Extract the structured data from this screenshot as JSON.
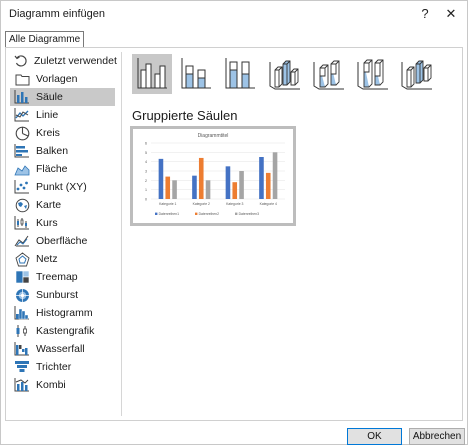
{
  "window": {
    "title": "Diagramm einfügen",
    "help": "?",
    "close": "✕"
  },
  "tabs": [
    {
      "label": "Alle Diagramme"
    }
  ],
  "sidebar": {
    "items": [
      {
        "label": "Zuletzt verwendet",
        "icon": "recent-icon"
      },
      {
        "label": "Vorlagen",
        "icon": "folder-icon"
      },
      {
        "label": "Säule",
        "icon": "column-chart-icon",
        "selected": true
      },
      {
        "label": "Linie",
        "icon": "line-chart-icon"
      },
      {
        "label": "Kreis",
        "icon": "pie-chart-icon"
      },
      {
        "label": "Balken",
        "icon": "bar-chart-icon"
      },
      {
        "label": "Fläche",
        "icon": "area-chart-icon"
      },
      {
        "label": "Punkt (XY)",
        "icon": "scatter-chart-icon"
      },
      {
        "label": "Karte",
        "icon": "map-chart-icon"
      },
      {
        "label": "Kurs",
        "icon": "stock-chart-icon"
      },
      {
        "label": "Oberfläche",
        "icon": "surface-chart-icon"
      },
      {
        "label": "Netz",
        "icon": "radar-chart-icon"
      },
      {
        "label": "Treemap",
        "icon": "treemap-icon"
      },
      {
        "label": "Sunburst",
        "icon": "sunburst-icon"
      },
      {
        "label": "Histogramm",
        "icon": "histogram-icon"
      },
      {
        "label": "Kastengrafik",
        "icon": "box-whisker-icon"
      },
      {
        "label": "Wasserfall",
        "icon": "waterfall-icon"
      },
      {
        "label": "Trichter",
        "icon": "funnel-icon"
      },
      {
        "label": "Kombi",
        "icon": "combo-chart-icon"
      }
    ]
  },
  "main": {
    "subtypes": [
      {
        "icon": "clustered-column-icon",
        "selected": true
      },
      {
        "icon": "stacked-column-icon"
      },
      {
        "icon": "100-stacked-column-icon"
      },
      {
        "icon": "3d-clustered-column-icon"
      },
      {
        "icon": "3d-stacked-column-icon"
      },
      {
        "icon": "3d-100-stacked-column-icon"
      },
      {
        "icon": "3d-column-icon"
      }
    ],
    "section_title": "Gruppierte Säulen"
  },
  "chart_data": {
    "type": "bar",
    "title": "Diagrammtitel",
    "categories": [
      "Kategorie 1",
      "Kategorie 2",
      "Kategorie 3",
      "Kategorie 4"
    ],
    "series": [
      {
        "name": "Datenreihen1",
        "values": [
          4.3,
          2.5,
          3.5,
          4.5
        ],
        "color": "#4472c4"
      },
      {
        "name": "Datenreihen2",
        "values": [
          2.4,
          4.4,
          1.8,
          2.8
        ],
        "color": "#ed7d31"
      },
      {
        "name": "Datenreihen3",
        "values": [
          2.0,
          2.0,
          3.0,
          5.0
        ],
        "color": "#a5a5a5"
      }
    ],
    "ylim": [
      0,
      6
    ],
    "yticks": [
      "0",
      "1",
      "2",
      "3",
      "4",
      "5",
      "6"
    ],
    "grid": true,
    "legend": "bottom"
  },
  "buttons": {
    "ok": "OK",
    "cancel": "Abbrechen"
  },
  "colors": {
    "accent": "#0078d7",
    "icon_blue": "#2e75b6",
    "selection": "#c9c9c9"
  }
}
